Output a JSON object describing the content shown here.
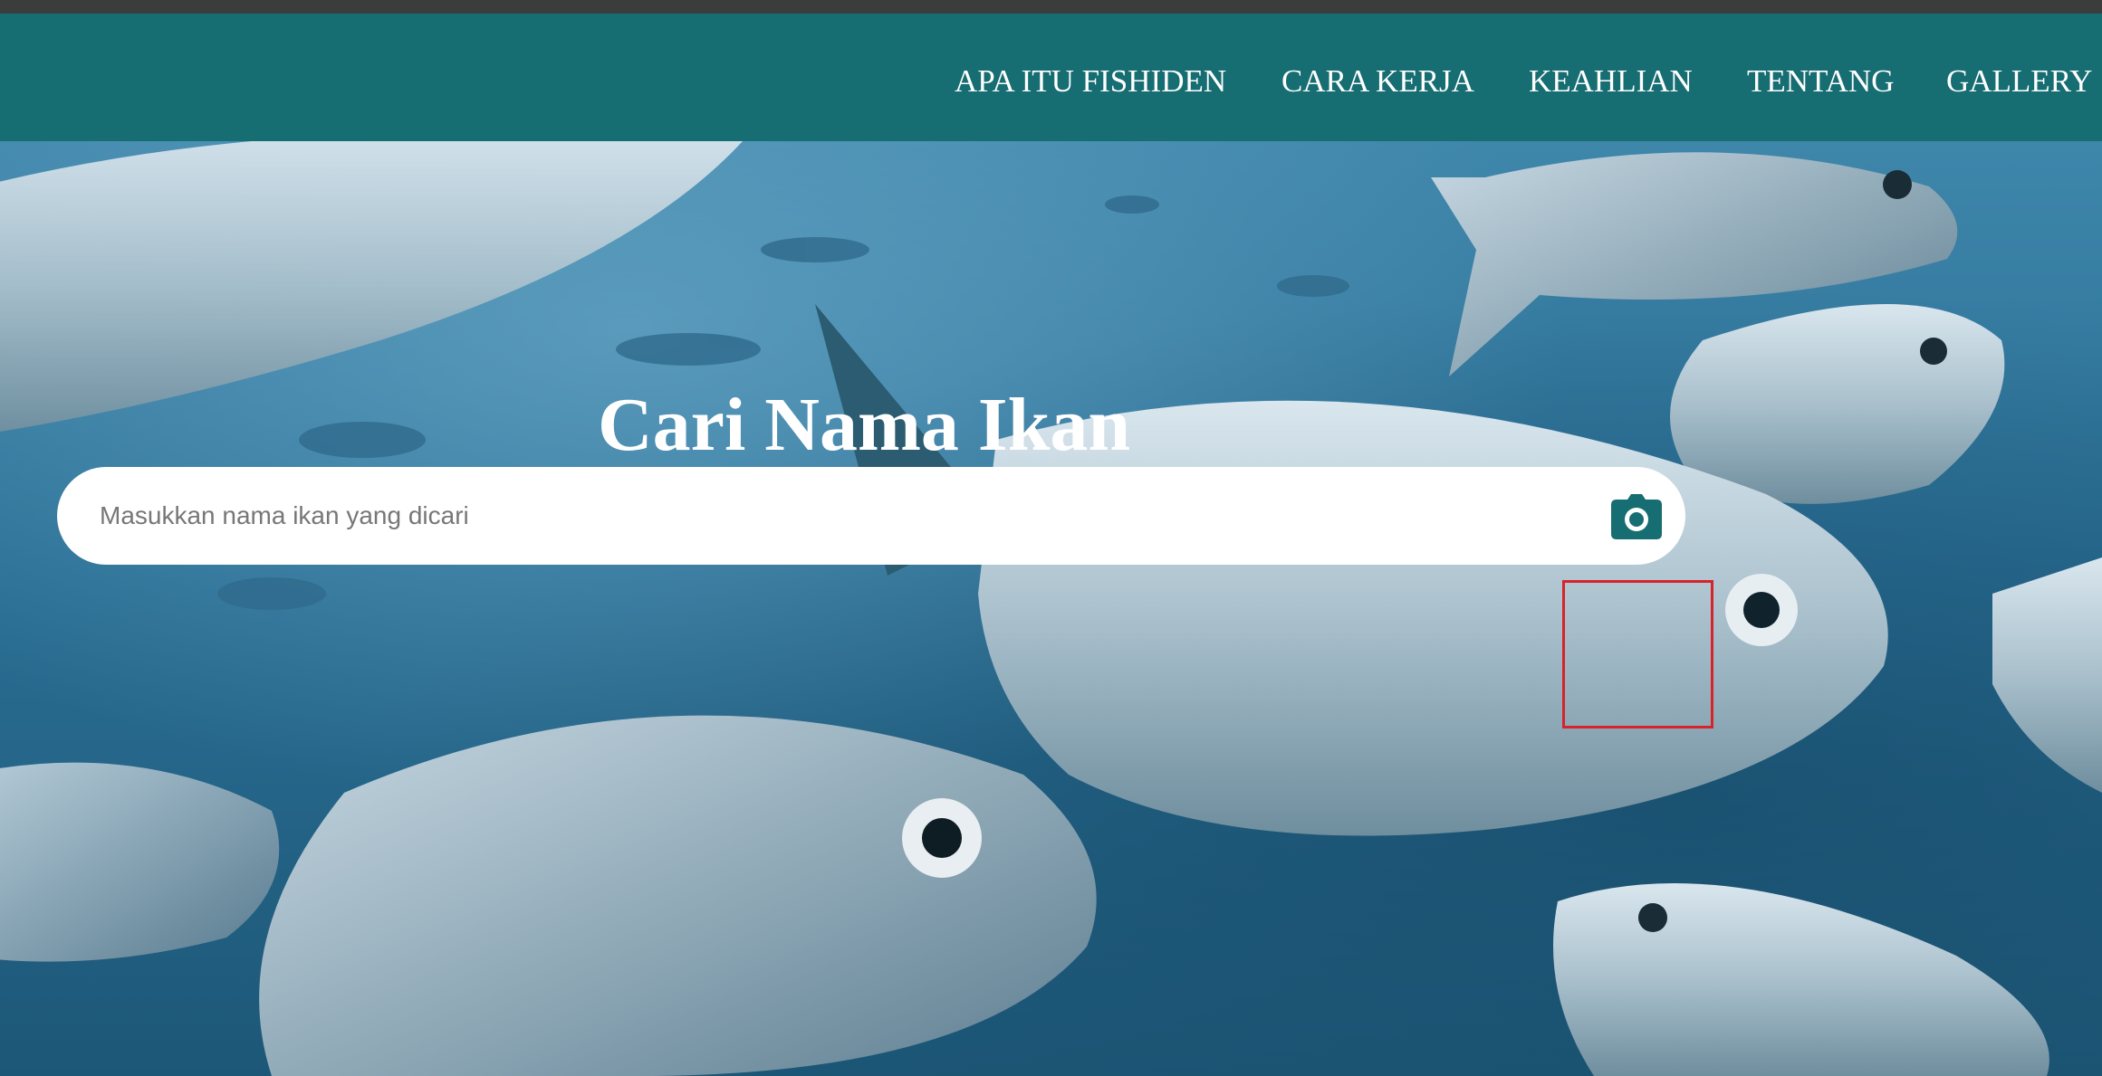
{
  "nav": {
    "items": [
      {
        "label": "APA ITU FISHIDEN"
      },
      {
        "label": "CARA KERJA"
      },
      {
        "label": "KEAHLIAN"
      },
      {
        "label": "TENTANG"
      },
      {
        "label": "GALLERY"
      }
    ]
  },
  "hero": {
    "title": "Cari Nama Ikan",
    "background": "school-of-silver-fish-underwater"
  },
  "search": {
    "placeholder": "Masukkan nama ikan yang dicari",
    "value": "",
    "camera_icon": "camera-icon"
  },
  "colors": {
    "navbar": "#166d72",
    "accent": "#166d72",
    "highlight": "#d6242a"
  }
}
